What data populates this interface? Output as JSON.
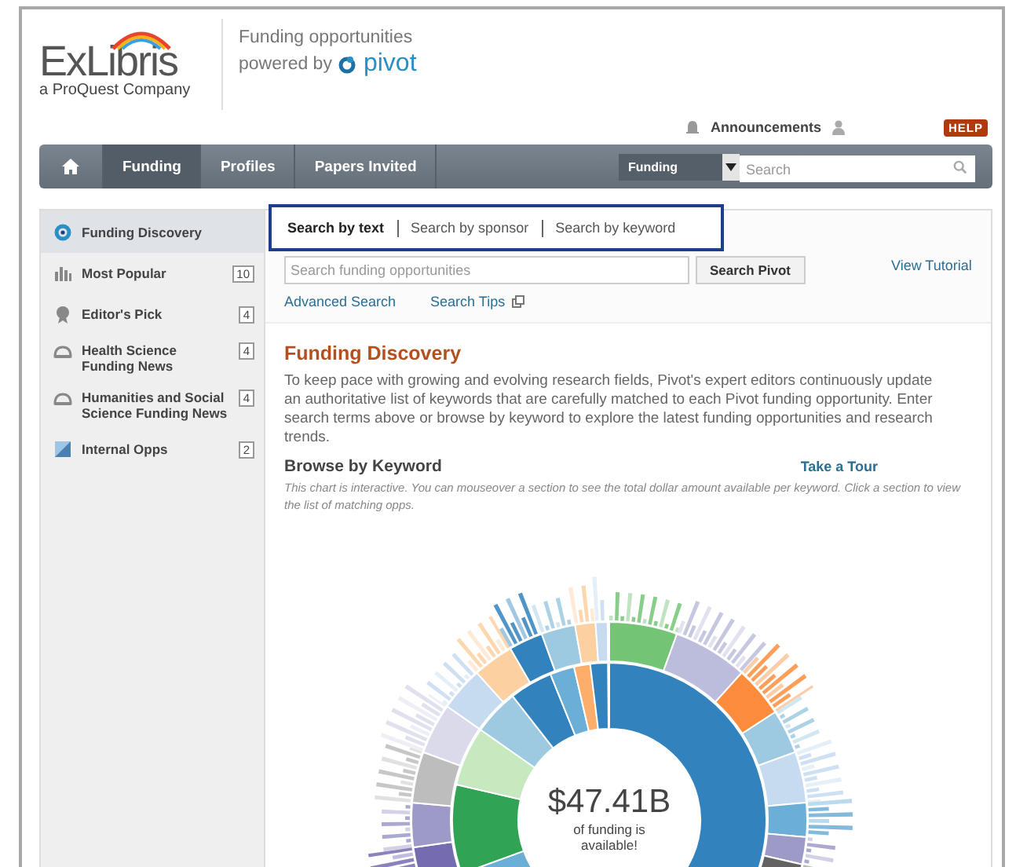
{
  "header": {
    "logo_name": "ExLibris",
    "logo_tagline": "a ProQuest Company",
    "title": "Funding opportunities",
    "powered_by": "powered by",
    "product": "pivot"
  },
  "utility_bar": {
    "announcements": "Announcements",
    "help": "HELP"
  },
  "nav": {
    "items": [
      {
        "kind": "home",
        "selected": false
      },
      {
        "kind": "text",
        "label": "Funding",
        "selected": true
      },
      {
        "kind": "text",
        "label": "Profiles",
        "selected": false
      },
      {
        "kind": "text",
        "label": "Papers Invited",
        "selected": false
      }
    ],
    "scope": "Funding",
    "search_placeholder": "Search"
  },
  "sidebar": {
    "items": [
      {
        "kind": "discovery",
        "label": "Funding Discovery",
        "selected": true
      },
      {
        "kind": "chart",
        "label": "Most Popular",
        "count": "10",
        "selected": false
      },
      {
        "kind": "award",
        "label": "Editor's Pick",
        "count": "4",
        "selected": false
      },
      {
        "kind": "news",
        "label": "Health Science Funding News",
        "count": "4",
        "selected": false
      },
      {
        "kind": "news",
        "label": "Humanities and Social Science Funding News",
        "count": "4",
        "selected": false
      },
      {
        "kind": "internal",
        "label": "Internal Opps",
        "count": "2",
        "selected": false
      }
    ]
  },
  "search_tabs": [
    {
      "label": "Search by text",
      "selected": true
    },
    {
      "label": "Search by sponsor",
      "selected": false
    },
    {
      "label": "Search by keyword",
      "selected": false
    }
  ],
  "search": {
    "placeholder": "Search funding opportunities",
    "button": "Search Pivot",
    "tutorial": "View Tutorial",
    "advanced": "Advanced Search",
    "tips": "Search Tips"
  },
  "discovery": {
    "title": "Funding Discovery",
    "description": "To keep pace with growing and evolving research fields, Pivot's expert editors continuously update an authoritative list of keywords that are carefully matched to each Pivot funding opportunity. Enter search terms above or browse by keyword to explore the latest funding opportunities and research trends."
  },
  "browse": {
    "title": "Browse by Keyword",
    "tour": "Take a Tour",
    "note": "This chart is interactive. You can mouseover a section to see the total dollar amount available per keyword. Click a section to view the list of matching opps.",
    "total": "$47.41B",
    "total_caption": "of funding is available!"
  }
}
